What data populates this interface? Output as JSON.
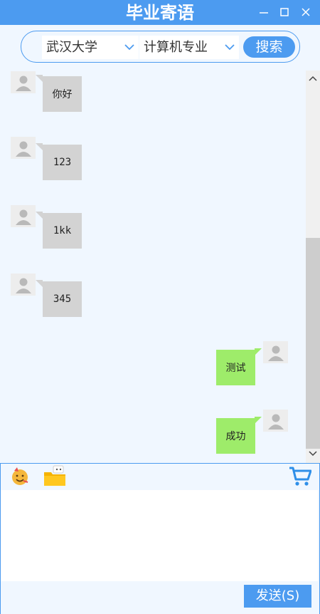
{
  "window": {
    "title": "毕业寄语",
    "accent_color": "#4c9bf0"
  },
  "search": {
    "university": "武汉大学",
    "major": "计算机专业",
    "button_label": "搜索"
  },
  "messages": [
    {
      "side": "left",
      "text": "你好"
    },
    {
      "side": "left",
      "text": "123"
    },
    {
      "side": "left",
      "text": "1kk"
    },
    {
      "side": "left",
      "text": "345"
    },
    {
      "side": "right",
      "text": "测试"
    },
    {
      "side": "right",
      "text": "成功"
    }
  ],
  "colors": {
    "incoming_bubble": "#d3d3d3",
    "outgoing_bubble": "#9eec6a"
  },
  "toolbar": {
    "icons": [
      "emoji-icon",
      "folder-icon",
      "cart-icon"
    ]
  },
  "composer": {
    "text": "",
    "send_label": "发送(S)"
  }
}
